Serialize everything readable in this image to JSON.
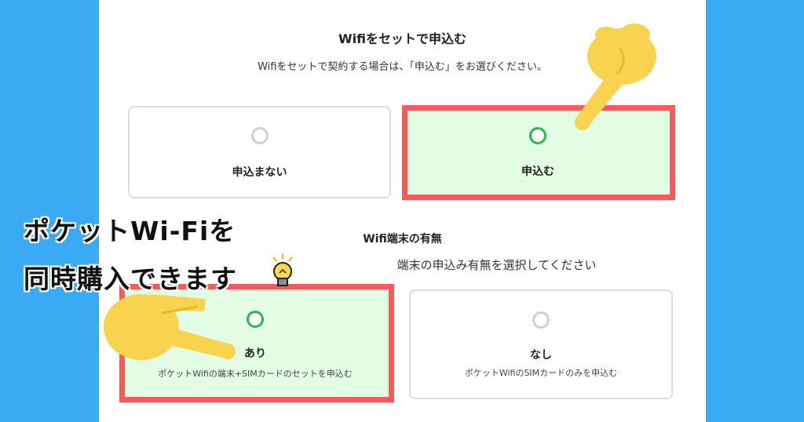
{
  "section1": {
    "title": "Wifiをセットで申込む",
    "description": "Wifiをセットで契約する場合は、「申込む」をお選びください。",
    "options": [
      {
        "label": "申込まない",
        "selected": false
      },
      {
        "label": "申込む",
        "selected": true
      }
    ]
  },
  "section2": {
    "title": "Wifi端末の有無",
    "description": "端末の申込み有無を選択してください",
    "options": [
      {
        "label": "あり",
        "sub": "ポケットWifiの端末+SIMカードのセットを申込む",
        "selected": true
      },
      {
        "label": "なし",
        "sub": "ポケットWifiのSIMカードのみを申込む",
        "selected": false
      }
    ]
  },
  "overlay": {
    "line1": "ポケットWi-Fiを",
    "line2": "同時購入できます"
  },
  "colors": {
    "background": "#3aaaf5",
    "highlight": "#f45b5b",
    "selected_fill": "#e3fde4",
    "radio_on": "#2db84c",
    "hand": "#f8d350"
  },
  "icons": [
    "pointing-hand-icon",
    "light-bulb-icon"
  ]
}
